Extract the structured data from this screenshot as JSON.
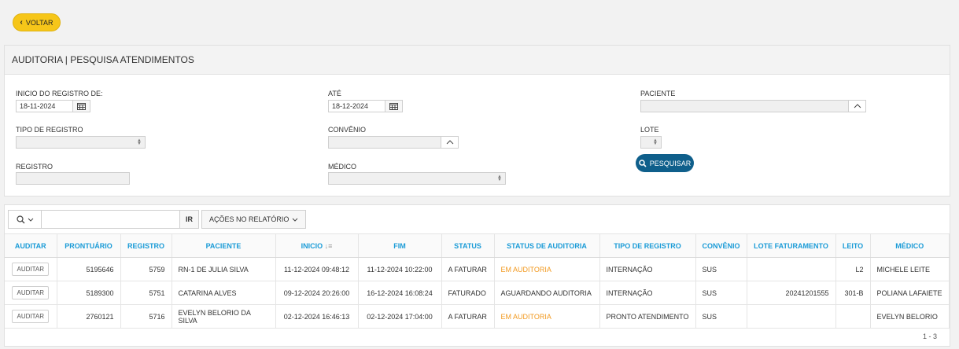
{
  "back_button": {
    "label": "VOLTAR"
  },
  "search_panel": {
    "title": "AUDITORIA | PESQUISA ATENDIMENTOS",
    "fields": {
      "inicio": {
        "label": "INICIO DO REGISTRO DE:",
        "value": "18-11-2024"
      },
      "ate": {
        "label": "ATÉ",
        "value": "18-12-2024"
      },
      "paciente": {
        "label": "PACIENTE",
        "value": ""
      },
      "tipo_registro": {
        "label": "TIPO DE REGISTRO",
        "value": ""
      },
      "convenio": {
        "label": "CONVÊNIO",
        "value": ""
      },
      "lote": {
        "label": "LOTE",
        "value": ""
      },
      "registro": {
        "label": "REGISTRO",
        "value": ""
      },
      "medico": {
        "label": "MÉDICO",
        "value": ""
      }
    },
    "search_button": "PESQUISAR"
  },
  "report": {
    "toolbar": {
      "go_label": "IR",
      "actions_label": "AÇÕES NO RELATÓRIO"
    },
    "columns": [
      "AUDITAR",
      "PRONTUÁRIO",
      "REGISTRO",
      "PACIENTE",
      "INICIO",
      "FIM",
      "STATUS",
      "STATUS DE AUDITORIA",
      "TIPO DE REGISTRO",
      "CONVÊNIO",
      "LOTE FATURAMENTO",
      "LEITO",
      "MÉDICO"
    ],
    "audit_button_label": "AUDITAR",
    "rows": [
      {
        "prontuario": "5195646",
        "registro": "5759",
        "paciente": "RN-1 DE JULIA SILVA",
        "inicio": "11-12-2024 09:48:12",
        "fim": "11-12-2024 10:22:00",
        "status": "A FATURAR",
        "status_auditoria": "EM AUDITORIA",
        "tipo": "INTERNAÇÃO",
        "convenio": "SUS",
        "lote": "",
        "leito": "L2",
        "medico": "MICHELE LEITE"
      },
      {
        "prontuario": "5189300",
        "registro": "5751",
        "paciente": "CATARINA ALVES",
        "inicio": "09-12-2024 20:26:00",
        "fim": "16-12-2024 16:08:24",
        "status": "FATURADO",
        "status_auditoria": "AGUARDANDO AUDITORIA",
        "tipo": "INTERNAÇÃO",
        "convenio": "SUS",
        "lote": "20241201555",
        "leito": "301-B",
        "medico": "POLIANA LAFAIETE"
      },
      {
        "prontuario": "2760121",
        "registro": "5716",
        "paciente": "EVELYN BELORIO DA SILVA",
        "inicio": "02-12-2024 16:46:13",
        "fim": "02-12-2024 17:04:00",
        "status": "A FATURAR",
        "status_auditoria": "EM AUDITORIA",
        "tipo": "PRONTO ATENDIMENTO",
        "convenio": "SUS",
        "lote": "",
        "leito": "",
        "medico": "EVELYN BELORIO"
      }
    ],
    "pagination": "1 - 3"
  },
  "colors": {
    "accent_yellow": "#f6c619",
    "primary_blue": "#0f5f8b",
    "header_text": "#1a9bd7",
    "audit_orange": "#f29a21"
  }
}
